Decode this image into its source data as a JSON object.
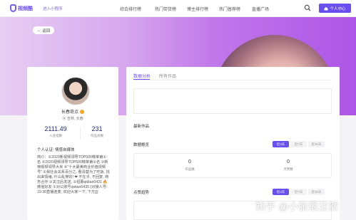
{
  "header": {
    "logo_text": "视频酷",
    "mini_program": "进入小程序",
    "nav": [
      "综合排行榜",
      "热门带货榜",
      "博主排行榜",
      "热门普荐榜",
      "直播广场"
    ],
    "personal_label": "个人中心"
  },
  "banner": {
    "back_label": "返回"
  },
  "profile": {
    "name": "长春奇点",
    "location": "吉林, 长春",
    "likes_value": "2111.49",
    "likes_label": "入驻指数",
    "works_value": "231",
    "works_label": "作品总数",
    "certification": "个人认证: 情感自媒体",
    "intro": "简介：①2020新视频领导TOP500榜单第①名 ②2020视频领导TOP500榜单第②名 ③新榜视频领导大米 ④”十大最美商业价值视频号” ①我社会关系百分之, 看清楚为了吃饭, 找出来情绪, 什么乱穿的! ❤ 不在乎, 不回复. 商务合作 ①关注后发送, ②招募qidian0431 🔥微信好友 ①对公账号qidian0435 (对接人号: 19:30直播连麦, 欢迎大家一下, 下方[])"
  },
  "tabs": {
    "analysis": "数据分析",
    "all_works": "所有作品"
  },
  "sections": {
    "latest": "最新作品",
    "overview": "数据概览",
    "trend": "点赞趋势"
  },
  "ranges": [
    "近3天",
    "近7天",
    "近30天"
  ],
  "kpis": [
    {
      "value": "0",
      "label": "作品数"
    },
    {
      "value": "0",
      "label": "点赞数"
    }
  ],
  "watermark": "知乎 @小张很注然",
  "colors": {
    "accent": "#6a4ff0",
    "banner_from": "#e7cff3",
    "banner_to": "#ad55e6"
  }
}
